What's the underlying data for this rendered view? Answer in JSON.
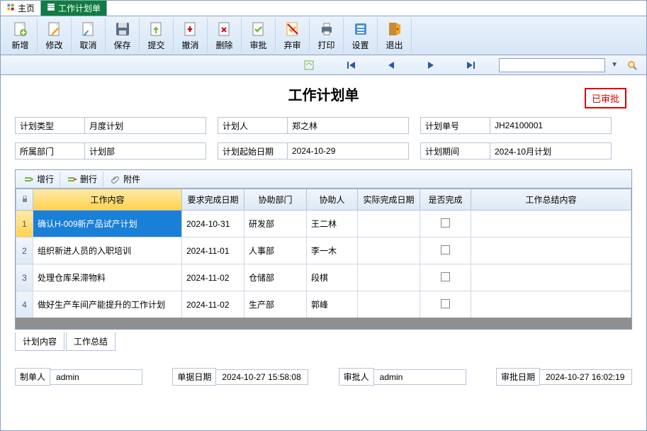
{
  "tabs": {
    "home": "主页",
    "workplan": "工作计划单"
  },
  "toolbar": {
    "add": "新增",
    "edit": "修改",
    "cancel": "取消",
    "save": "保存",
    "submit": "提交",
    "revoke": "撤消",
    "delete": "删除",
    "approve": "审批",
    "discard": "弃审",
    "print": "打印",
    "settings": "设置",
    "exit": "退出"
  },
  "title": "工作计划单",
  "stamp": "已审批",
  "form": {
    "plan_type_label": "计划类型",
    "plan_type": "月度计划",
    "department_label": "所属部门",
    "department": "计划部",
    "planner_label": "计划人",
    "planner": "郑之林",
    "start_date_label": "计划起始日期",
    "start_date": "2024-10-29",
    "plan_no_label": "计划单号",
    "plan_no": "JH24100001",
    "plan_period_label": "计划期间",
    "plan_period": "2024-10月计划"
  },
  "grid": {
    "toolbar": {
      "addrow": "增行",
      "delrow": "删行",
      "attach": "附件"
    },
    "columns": {
      "content": "工作内容",
      "due": "要求完成日期",
      "assist_dept": "协助部门",
      "assist_person": "协助人",
      "actual": "实际完成日期",
      "done": "是否完成",
      "summary": "工作总结内容"
    },
    "rows": [
      {
        "n": "1",
        "content": "确认H-009新产品试产计划",
        "due": "2024-10-31",
        "dept": "研发部",
        "person": "王二林",
        "actual": "",
        "summary": ""
      },
      {
        "n": "2",
        "content": "组织新进人员的入职培训",
        "due": "2024-11-01",
        "dept": "人事部",
        "person": "李一木",
        "actual": "",
        "summary": ""
      },
      {
        "n": "3",
        "content": "处理仓库呆滞物料",
        "due": "2024-11-02",
        "dept": "仓储部",
        "person": "段棋",
        "actual": "",
        "summary": ""
      },
      {
        "n": "4",
        "content": "做好生产车间产能提升的工作计划",
        "due": "2024-11-02",
        "dept": "生产部",
        "person": "郭峰",
        "actual": "",
        "summary": ""
      }
    ]
  },
  "bottom_tabs": {
    "content": "计划内容",
    "summary": "工作总结"
  },
  "footer": {
    "creator_label": "制单人",
    "creator": "admin",
    "doc_date_label": "单据日期",
    "doc_date": "2024-10-27 15:58:08",
    "approver_label": "审批人",
    "approver": "admin",
    "approve_date_label": "审批日期",
    "approve_date": "2024-10-27 16:02:19"
  }
}
